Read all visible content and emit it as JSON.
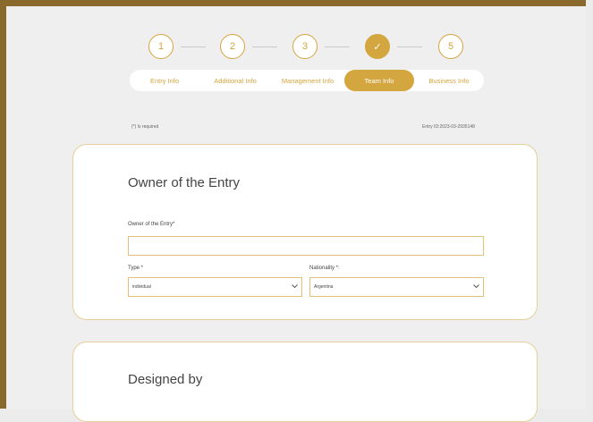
{
  "stepper": {
    "steps": [
      {
        "label": "1",
        "done": false
      },
      {
        "label": "2",
        "done": false
      },
      {
        "label": "3",
        "done": false
      },
      {
        "label": "✓",
        "done": true
      },
      {
        "label": "5",
        "done": false
      }
    ]
  },
  "tabs": [
    {
      "label": "Entry Info",
      "active": false
    },
    {
      "label": "Additional Info",
      "active": false
    },
    {
      "label": "Management Info",
      "active": false
    },
    {
      "label": "Team Info",
      "active": true
    },
    {
      "label": "Business Info",
      "active": false
    }
  ],
  "form_meta": {
    "required_note": "(*) Is required",
    "entry_id": "Entry ID:2023-03-2935148"
  },
  "owner_card": {
    "title": "Owner of the Entry",
    "owner_label": "Owner of the Entry*",
    "owner_value": "",
    "type_label": "Type *",
    "type_value": "individual",
    "nationality_label": "Nationality *:",
    "nationality_value": "Argentina"
  },
  "designed_card": {
    "title": "Designed by"
  },
  "colors": {
    "accent": "#d4a63f",
    "frame": "#8a6a2c",
    "background": "#efefef"
  }
}
